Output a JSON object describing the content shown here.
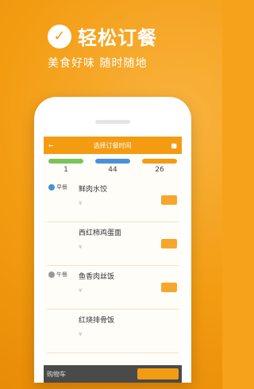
{
  "brand": {
    "app_name": "轻松订餐",
    "slogan": "美食好味 随时随地"
  },
  "screen": {
    "header_left": "←",
    "header_title": "选择订餐时间",
    "header_right": "■",
    "stats": [
      {
        "value": "1",
        "color": "#7cc35b"
      },
      {
        "value": "44",
        "color": "#4a90d9"
      },
      {
        "value": "26",
        "color": "#f39c12"
      }
    ],
    "list": [
      {
        "left_label": "早餐",
        "title": "鲜肉水饺",
        "sub": "¥"
      },
      {
        "left_label": "",
        "title": "西红柿鸡蛋面",
        "sub": "¥"
      },
      {
        "left_label": "午餐",
        "title": "鱼香肉丝饭",
        "sub": "¥"
      },
      {
        "left_label": "",
        "title": "红烧排骨饭",
        "sub": "¥"
      }
    ],
    "bottom_left": "购物车"
  }
}
